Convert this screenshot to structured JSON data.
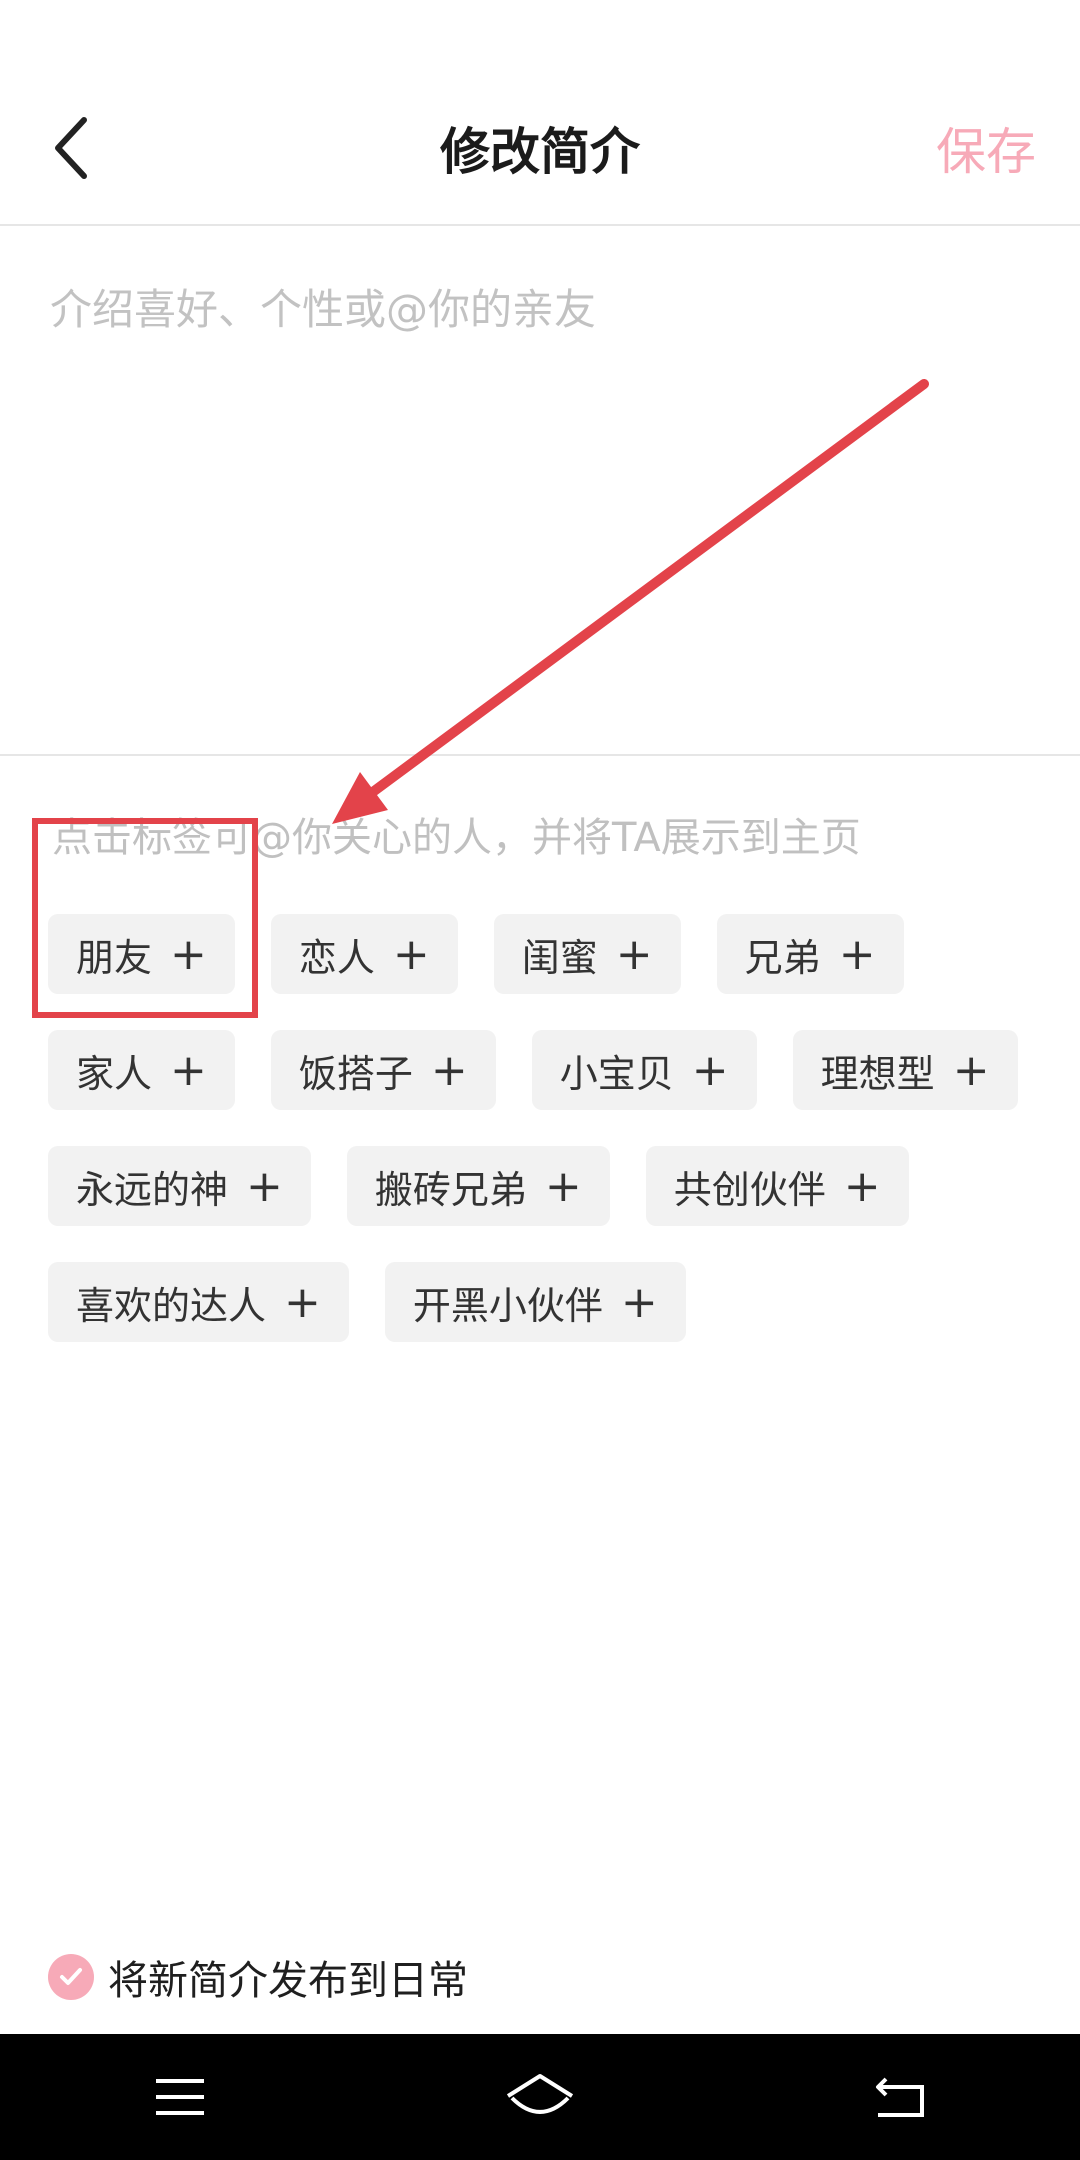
{
  "header": {
    "title": "修改简介",
    "save_label": "保存",
    "back_icon": "chevron-left-icon"
  },
  "intro": {
    "placeholder": "介绍喜好、个性或@你的亲友",
    "value": ""
  },
  "hint": "点击标签可@你关心的人，并将TA展示到主页",
  "tags": [
    [
      "朋友",
      "恋人",
      "闺蜜",
      "兄弟"
    ],
    [
      "家人",
      "饭搭子",
      "小宝贝",
      "理想型"
    ],
    [
      "永远的神",
      "搬砖兄弟",
      "共创伙伴"
    ],
    [
      "喜欢的达人",
      "开黑小伙伴"
    ]
  ],
  "tag_plus": "+",
  "publish": {
    "label": "将新简介发布到日常",
    "checked": true
  },
  "colors": {
    "accent": "#f7aab8",
    "annotation": "#e3434a",
    "tag_bg": "#f2f2f2",
    "placeholder": "#c2c2c2"
  },
  "navbar": {
    "icons": [
      "menu-icon",
      "home-icon",
      "back-icon"
    ]
  }
}
